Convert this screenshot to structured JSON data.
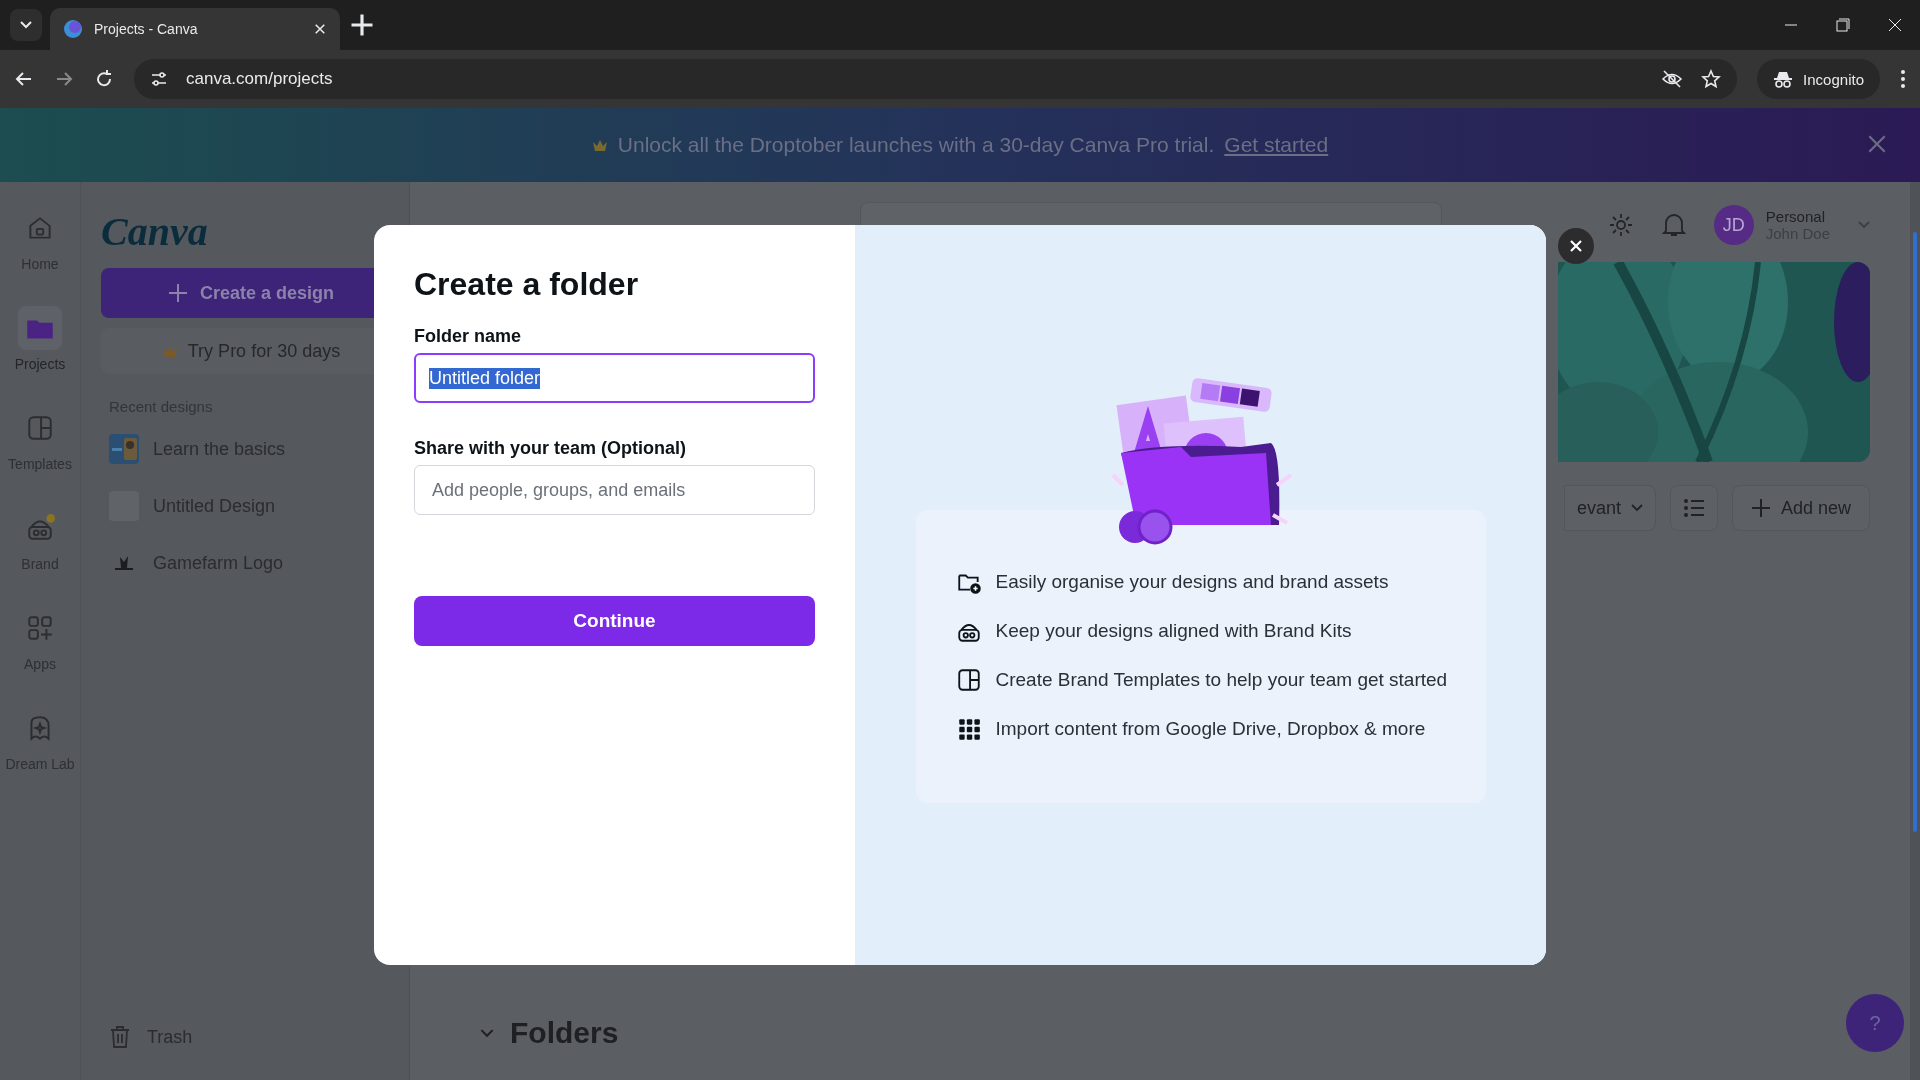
{
  "browser": {
    "tab_title": "Projects - Canva",
    "url": "canva.com/projects",
    "profile": "Incognito"
  },
  "banner": {
    "text": "Unlock all the Droptober launches with a 30-day Canva Pro trial.",
    "link": "Get started"
  },
  "rail": [
    {
      "kind": "home",
      "label": "Home",
      "selected": false
    },
    {
      "kind": "projects",
      "label": "Projects",
      "selected": true
    },
    {
      "kind": "templates",
      "label": "Templates",
      "selected": false
    },
    {
      "kind": "brand",
      "label": "Brand",
      "selected": false
    },
    {
      "kind": "apps",
      "label": "Apps",
      "selected": false
    },
    {
      "kind": "dreamlab",
      "label": "Dream Lab",
      "selected": false
    }
  ],
  "sidebar": {
    "logo": "Canva",
    "create_button": "Create a design",
    "pro_button": "Try Pro for 30 days",
    "recent_heading": "Recent designs",
    "recent": [
      {
        "title": "Learn the basics"
      },
      {
        "kind": "blank",
        "title": "Untitled Design"
      },
      {
        "kind": "logo",
        "title": "Gamefarm Logo"
      }
    ],
    "trash": "Trash"
  },
  "header": {
    "avatar": "JD",
    "account_type": "Personal",
    "user_name": "John Doe"
  },
  "toolbar": {
    "sort": "evant",
    "add_button": "Add new"
  },
  "folders_heading": "Folders",
  "help": "?",
  "dialog": {
    "title": "Create a folder",
    "name_label": "Folder name",
    "name_value": "Untitled folder",
    "share_label": "Share with your team (Optional)",
    "share_placeholder": "Add people, groups, and emails",
    "continue": "Continue",
    "features": [
      {
        "kind": "folder",
        "text": "Easily organise your designs and brand assets"
      },
      {
        "kind": "brand",
        "text": "Keep your designs aligned with Brand Kits"
      },
      {
        "kind": "template",
        "text": "Create Brand Templates to help your team get started"
      },
      {
        "kind": "grid",
        "text": "Import content from Google Drive, Dropbox & more"
      }
    ]
  }
}
